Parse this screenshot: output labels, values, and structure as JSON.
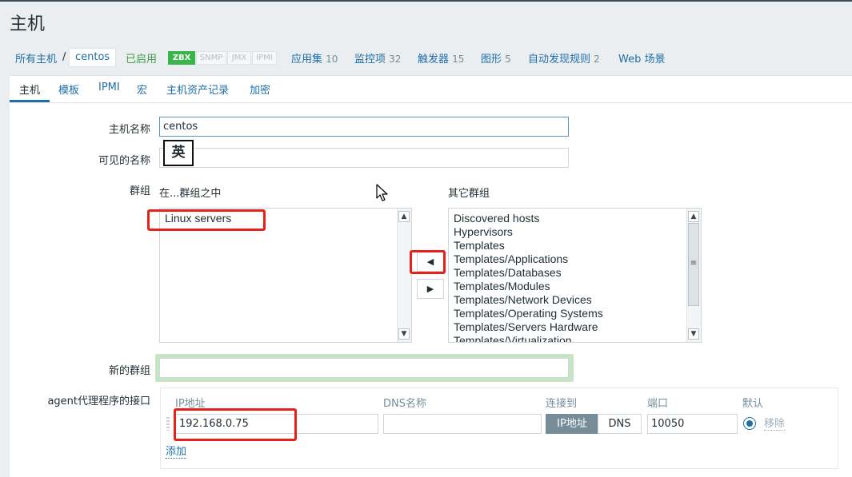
{
  "page": {
    "title": "主机"
  },
  "breadcrumb": {
    "all_hosts": "所有主机",
    "separator": "/",
    "current": "centos"
  },
  "host_nav": {
    "status": "已启用",
    "availability": [
      "ZBX",
      "SNMP",
      "JMX",
      "IPMI"
    ],
    "links": [
      {
        "label": "应用集",
        "count": "10"
      },
      {
        "label": "监控项",
        "count": "32"
      },
      {
        "label": "触发器",
        "count": "15"
      },
      {
        "label": "图形",
        "count": "5"
      },
      {
        "label": "自动发现规则",
        "count": "2"
      },
      {
        "label": "Web 场景",
        "count": ""
      }
    ]
  },
  "tabs": [
    "主机",
    "模板",
    "IPMI",
    "宏",
    "主机资产记录",
    "加密"
  ],
  "form": {
    "host_name_label": "主机名称",
    "host_name_value": "centos",
    "visible_name_label": "可见的名称",
    "visible_name_value": "",
    "ime_indicator": "英",
    "groups_label": "群组",
    "in_groups_label": "在...群组之中",
    "other_groups_label": "其它群组",
    "in_groups": [
      "Linux servers"
    ],
    "other_groups": [
      "Discovered hosts",
      "Hypervisors",
      "Templates",
      "Templates/Applications",
      "Templates/Databases",
      "Templates/Modules",
      "Templates/Network Devices",
      "Templates/Operating Systems",
      "Templates/Servers Hardware",
      "Templates/Virtualization"
    ],
    "new_group_label": "新的群组",
    "new_group_value": "",
    "agent_interfaces_label": "agent代理程序的接口",
    "interface": {
      "headers": {
        "ip": "IP地址",
        "dns": "DNS名称",
        "connect_to": "连接到",
        "port": "端口",
        "default": "默认"
      },
      "ip_value": "192.168.0.75",
      "dns_value": "",
      "connect_ip": "IP地址",
      "connect_dns": "DNS",
      "port_value": "10050",
      "remove": "移除",
      "add": "添加"
    }
  },
  "colors": {
    "highlight": "#e8201a",
    "accent": "#1f6ea8",
    "zbx_green": "#39b54a"
  }
}
